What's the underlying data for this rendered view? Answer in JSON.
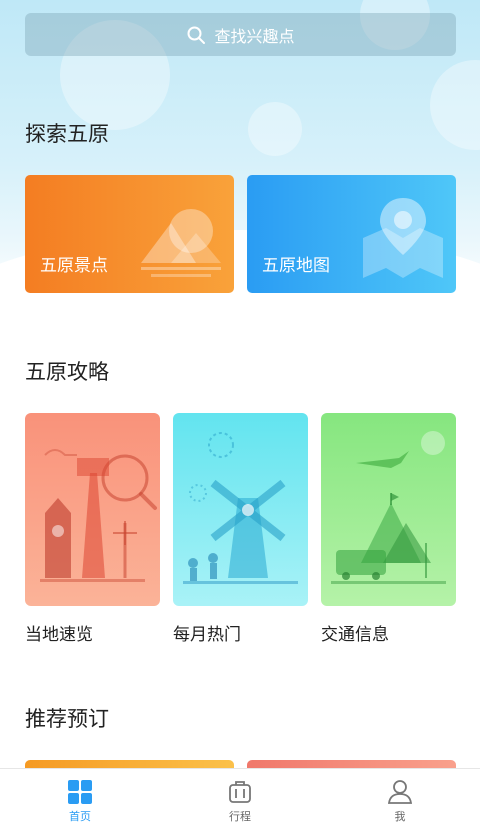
{
  "search": {
    "placeholder": "查找兴趣点"
  },
  "sections": {
    "explore": {
      "title": "探索五原",
      "cards": [
        {
          "label": "五原景点",
          "icon": "mountain-sun-icon"
        },
        {
          "label": "五原地图",
          "icon": "map-pin-icon"
        }
      ]
    },
    "guide": {
      "title": "五原攻略",
      "cards": [
        {
          "label": "当地速览",
          "icon": "landmarks-icon"
        },
        {
          "label": "每月热门",
          "icon": "windmill-icon"
        },
        {
          "label": "交通信息",
          "icon": "transport-icon"
        }
      ]
    },
    "reserve": {
      "title": "推荐预订"
    }
  },
  "tabbar": {
    "items": [
      {
        "label": "首页",
        "icon": "home-grid-icon",
        "active": true
      },
      {
        "label": "行程",
        "icon": "luggage-icon",
        "active": false
      },
      {
        "label": "我",
        "icon": "person-icon",
        "active": false
      }
    ]
  },
  "colors": {
    "accent": "#2a9cf3"
  }
}
